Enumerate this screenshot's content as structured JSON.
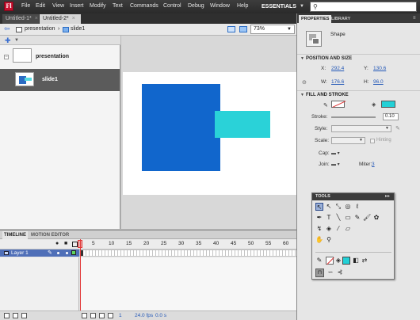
{
  "menubar": {
    "logo": "Fl",
    "items": [
      "File",
      "Edit",
      "View",
      "Insert",
      "Modify",
      "Text",
      "Commands",
      "Control",
      "Debug",
      "Window",
      "Help"
    ],
    "workspace": "ESSENTIALS",
    "search_placeholder": ""
  },
  "doc_tabs": [
    {
      "label": "Untitled-1*",
      "close": "×"
    },
    {
      "label": "Untitled-2*",
      "close": "×"
    }
  ],
  "editbar": {
    "breadcrumb": [
      "presentation",
      "slide1"
    ],
    "zoom": "73%"
  },
  "outline": {
    "screens": [
      {
        "label": "presentation"
      },
      {
        "label": "slide1"
      }
    ]
  },
  "stage": {
    "colors": {
      "square": "#1166cc",
      "rect": "#30e0e4",
      "background": "#ffffff"
    }
  },
  "timeline": {
    "tabs": [
      "TIMELINE",
      "MOTION EDITOR"
    ],
    "frame_numbers": [
      "5",
      "10",
      "15",
      "20",
      "25",
      "30",
      "35",
      "40",
      "45",
      "50",
      "55",
      "60"
    ],
    "layer": {
      "name": "Layer 1"
    },
    "footer": {
      "frame": "1",
      "fps": "24.0 fps",
      "time": "0.0 s"
    }
  },
  "properties": {
    "tabs": [
      "PROPERTIES",
      "LIBRARY"
    ],
    "object_type": "Shape",
    "position_section": "POSITION AND SIZE",
    "x_label": "X:",
    "x_value": "292.4",
    "y_label": "Y:",
    "y_value": "130.6",
    "w_label": "W:",
    "w_value": "176.6",
    "h_label": "H:",
    "h_value": "96.0",
    "fill_section": "FILL AND STROKE",
    "stroke_label": "Stroke:",
    "stroke_value": "0.10",
    "style_label": "Style:",
    "scale_label": "Scale:",
    "hinting_label": "Hinting",
    "cap_label": "Cap:",
    "join_label": "Join:",
    "miter_label": "Miter:",
    "miter_value": "3",
    "fill_color": "#22d0d6"
  },
  "tools": {
    "title": "TOOLS"
  }
}
